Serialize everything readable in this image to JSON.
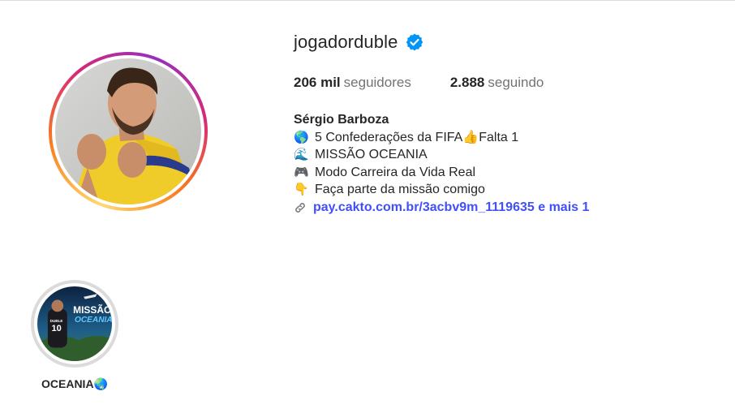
{
  "profile": {
    "username": "jogadorduble",
    "verified_icon": "verified-badge-icon",
    "stats": [
      {
        "number": "206 mil",
        "label": "seguidores"
      },
      {
        "number": "2.888",
        "label": "seguindo"
      }
    ],
    "bio": {
      "name": "Sérgio Barboza",
      "lines": [
        {
          "icon": "🌎",
          "text": "5 Confederações da FIFA👍Falta 1"
        },
        {
          "icon": "🌊",
          "text": "MISSÃO OCEANIA"
        },
        {
          "icon": "🎮",
          "text": "Modo Carreira da Vida Real"
        },
        {
          "icon": "👇",
          "text": "Faça parte da missão comigo"
        }
      ],
      "link": "pay.cakto.com.br/3acbv9m_1119635 e mais 1"
    }
  },
  "highlights": [
    {
      "label": "OCEANIA🌏",
      "image_text_1": "MISSÃO",
      "image_text_2": "OCEANIA",
      "image_text_3": "DUBLE",
      "image_text_4": "10"
    }
  ],
  "colors": {
    "link": "#4150f7",
    "verified": "#0095f6",
    "muted": "#737373"
  }
}
